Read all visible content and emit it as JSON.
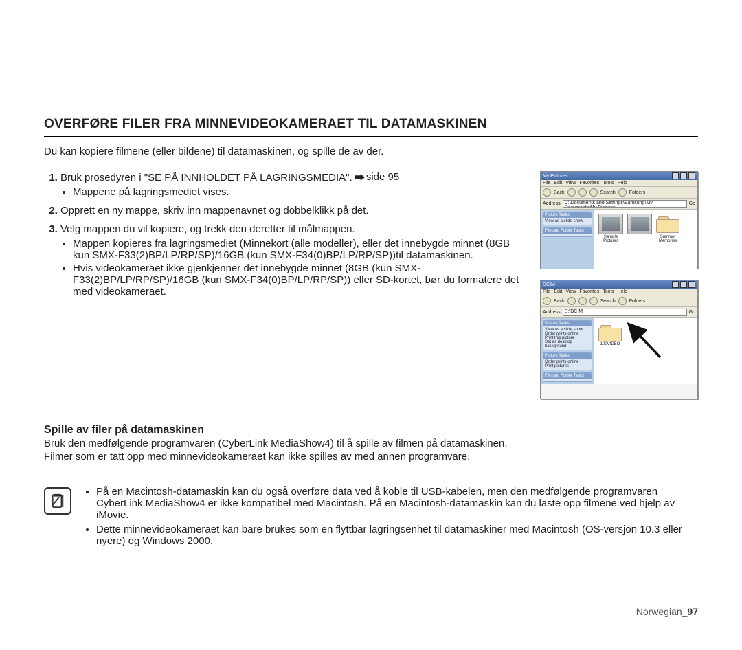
{
  "heading": "OVERFØRE FILER FRA MINNEVIDEOKAMERAET TIL DATAMASKINEN",
  "intro": "Du kan kopiere filmene (eller bildene) til datamaskinen, og spille de av der.",
  "steps": [
    {
      "text": "Bruk prosedyren i \"SE PÅ INNHOLDET PÅ LAGRINGSMEDIA\".",
      "page_ref": "side 95",
      "sub": [
        "Mappene på lagringsmediet vises."
      ]
    },
    {
      "text": "Opprett en ny mappe, skriv inn mappenavnet og dobbelklikk på det.",
      "sub": []
    },
    {
      "text": "Velg mappen du vil kopiere, og trekk den deretter til målmappen.",
      "sub": [
        "Mappen kopieres fra lagringsmediet (Minnekort (alle modeller), eller det innebygde minnet (8GB kun SMX-F33(2)BP/LP/RP/SP)/16GB (kun SMX-F34(0)BP/LP/RP/SP))til datamaskinen.",
        "Hvis videokameraet ikke gjenkjenner det innebygde minnet (8GB (kun SMX-F33(2)BP/LP/RP/SP)/16GB (kun SMX-F34(0)BP/LP/RP/SP)) eller SD-kortet, bør du formatere det med videokameraet."
      ]
    }
  ],
  "subheading": "Spille av filer på datamaskinen",
  "sub_paras": [
    "Bruk den medfølgende programvaren (CyberLink MediaShow4) til å spille av filmen på datamaskinen.",
    "Filmer som er tatt opp med minnevideokameraet kan ikke spilles av med annen programvare."
  ],
  "notes": [
    "På en Macintosh-datamaskin kan du også overføre data ved å koble til USB-kabelen, men den medfølgende programvaren CyberLink MediaShow4 er ikke kompatibel med Macintosh. På en Macintosh-datamaskin kan du laste opp filmene ved hjelp av iMovie.",
    "Dette minnevideokameraet kan bare brukes som en flyttbar lagringsenhet til datamaskiner med Macintosh (OS-versjon 10.3 eller nyere) og Windows 2000."
  ],
  "footer": {
    "text": "Norwegian_",
    "page": "97"
  },
  "win1": {
    "title": "My Pictures",
    "menu": [
      "File",
      "Edit",
      "View",
      "Favorites",
      "Tools",
      "Help"
    ],
    "back": "Back",
    "search": "Search",
    "folders": "Folders",
    "address_label": "Address",
    "address": "C:\\Documents and Settings\\Samsung\\My Documents\\My Pictures",
    "go": "Go",
    "task1_title": "Picture Tasks",
    "task1_items": [
      "View as a slide show"
    ],
    "task2_title": "File and Folder Tasks",
    "thumbs": [
      "Sample Pictures"
    ],
    "folder_label": "Summer Memories"
  },
  "win2": {
    "title": "DCIM",
    "menu": [
      "File",
      "Edit",
      "View",
      "Favorites",
      "Tools",
      "Help"
    ],
    "back": "Back",
    "search": "Search",
    "folders": "Folders",
    "address_label": "Address",
    "address": "E:\\DCIM",
    "go": "Go",
    "task1_title": "Picture Tasks",
    "task1_items": [
      "View as a slide show",
      "Order prints online",
      "Print this picture",
      "Set as desktop background"
    ],
    "task2_title": "Picture Tasks",
    "task2_items": [
      "Order prints online",
      "Print pictures"
    ],
    "task3_title": "File and Folder Tasks",
    "folder_label": "100VIDEO"
  }
}
